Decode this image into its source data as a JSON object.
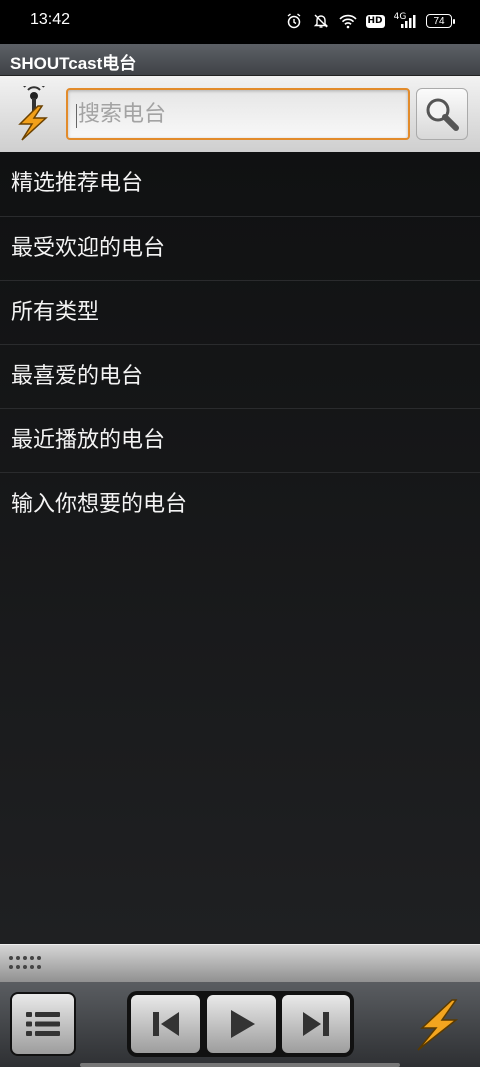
{
  "status_bar": {
    "time": "13:42",
    "icons": [
      "alarm-icon",
      "mute-icon",
      "wifi-icon",
      "hd-icon",
      "signal-icon",
      "battery-icon"
    ],
    "hd_label": "HD",
    "network": "4G",
    "battery": "74"
  },
  "app": {
    "title": "SHOUTcast电台"
  },
  "search": {
    "placeholder": "搜索电台",
    "value": ""
  },
  "menu": {
    "items": [
      {
        "label": "精选推荐电台"
      },
      {
        "label": "最受欢迎的电台"
      },
      {
        "label": "所有类型"
      },
      {
        "label": "最喜爱的电台"
      },
      {
        "label": "最近播放的电台"
      },
      {
        "label": "输入你想要的电台"
      }
    ]
  },
  "colors": {
    "accent": "#e28b2b",
    "list_bg": "#151618",
    "title_bar": "#4a4d52"
  },
  "player": {
    "controls": [
      "menu-list-icon",
      "previous-icon",
      "play-icon",
      "next-icon",
      "winamp-bolt-icon"
    ]
  }
}
